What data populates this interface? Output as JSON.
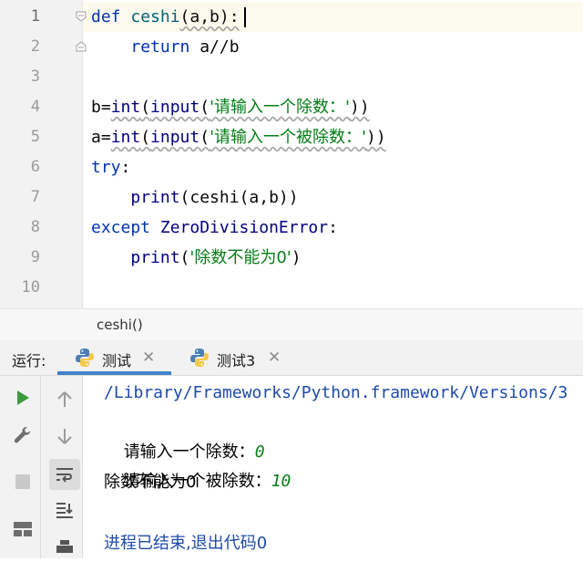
{
  "editor": {
    "line_numbers": [
      "1",
      "2",
      "3",
      "4",
      "5",
      "6",
      "7",
      "8",
      "9",
      "10"
    ],
    "lines": [
      {
        "tokens": [
          {
            "t": "def ",
            "c": "kw"
          },
          {
            "t": "ceshi",
            "c": "fn"
          },
          {
            "t": "(a,b):",
            "c": ""
          }
        ]
      },
      {
        "tokens": [
          {
            "t": "    ",
            "c": ""
          },
          {
            "t": "return ",
            "c": "kw"
          },
          {
            "t": "a//b",
            "c": ""
          }
        ]
      },
      {
        "tokens": []
      },
      {
        "tokens": [
          {
            "t": "b=",
            "c": ""
          },
          {
            "t": "int",
            "c": "bi"
          },
          {
            "t": "(",
            "c": ""
          },
          {
            "t": "input",
            "c": "bi"
          },
          {
            "t": "(",
            "c": ""
          },
          {
            "t": "'请输入一个除数：'",
            "c": "str"
          },
          {
            "t": "))",
            "c": ""
          }
        ]
      },
      {
        "tokens": [
          {
            "t": "a=",
            "c": ""
          },
          {
            "t": "int",
            "c": "bi"
          },
          {
            "t": "(",
            "c": ""
          },
          {
            "t": "input",
            "c": "bi"
          },
          {
            "t": "(",
            "c": ""
          },
          {
            "t": "'请输入一个被除数：'",
            "c": "str"
          },
          {
            "t": "))",
            "c": ""
          }
        ]
      },
      {
        "tokens": [
          {
            "t": "try",
            "c": "kw"
          },
          {
            "t": ":",
            "c": ""
          }
        ]
      },
      {
        "tokens": [
          {
            "t": "    ",
            "c": ""
          },
          {
            "t": "print",
            "c": "bi"
          },
          {
            "t": "(ceshi(a,b))",
            "c": ""
          }
        ]
      },
      {
        "tokens": [
          {
            "t": "except ",
            "c": "kw"
          },
          {
            "t": "ZeroDivisionError",
            "c": "bi"
          },
          {
            "t": ":",
            "c": ""
          }
        ]
      },
      {
        "tokens": [
          {
            "t": "    ",
            "c": ""
          },
          {
            "t": "print",
            "c": "bi"
          },
          {
            "t": "(",
            "c": ""
          },
          {
            "t": "'除数不能为0'",
            "c": "str"
          },
          {
            "t": ")",
            "c": ""
          }
        ]
      },
      {
        "tokens": []
      }
    ],
    "breadcrumb": "ceshi()"
  },
  "run_panel": {
    "label": "运行:",
    "tabs": [
      {
        "label": "测试",
        "active": true
      },
      {
        "label": "测试3",
        "active": false
      }
    ],
    "output": [
      {
        "text": "/Library/Frameworks/Python.framework/Versions/3",
        "kind": "path"
      },
      {
        "prompt": "请输入一个除数：",
        "input": "0"
      },
      {
        "prompt": "请输入一个被除数：",
        "input": "10"
      },
      {
        "text": "除数不能为0",
        "kind": "plain"
      },
      {
        "text": "",
        "kind": "plain"
      },
      {
        "text": "进程已结束,退出代码0",
        "kind": "path"
      }
    ]
  },
  "colors": {
    "keyword": "#0033b3",
    "function": "#00627a",
    "builtin": "#000080",
    "string": "#067d17",
    "run_green": "#3d9b3d",
    "tab_underline": "#4083c9",
    "console_path": "#1f4ba8"
  },
  "icons": [
    "run-icon",
    "wrench-icon",
    "stop-icon",
    "layout-icon",
    "up-arrow-icon",
    "down-arrow-icon",
    "soft-wrap-icon",
    "scroll-to-end-icon",
    "print-icon",
    "python-icon",
    "close-icon",
    "fold-marker-icon"
  ]
}
